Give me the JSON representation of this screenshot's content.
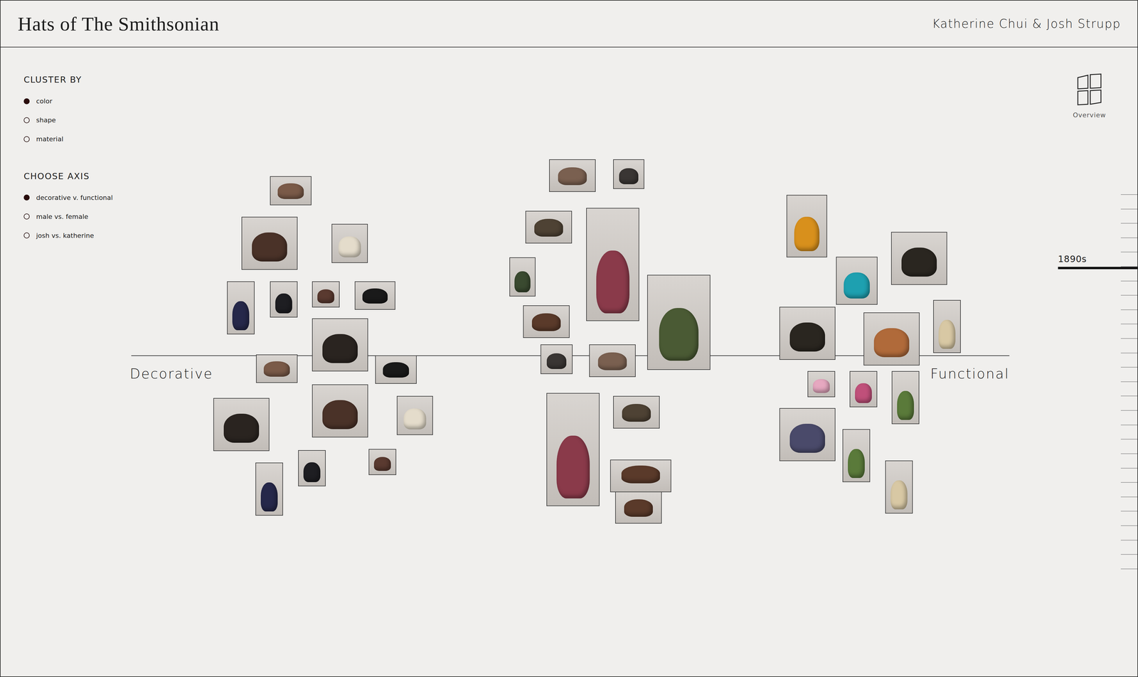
{
  "header": {
    "title": "Hats of The Smithsonian",
    "authors": "Katherine Chui & Josh Strupp"
  },
  "cluster_by": {
    "heading": "CLUSTER BY",
    "options": [
      {
        "label": "color",
        "selected": true
      },
      {
        "label": "shape",
        "selected": false
      },
      {
        "label": "material",
        "selected": false
      }
    ]
  },
  "axis_choice": {
    "heading": "CHOOSE AXIS",
    "options": [
      {
        "label": "decorative v. functional",
        "selected": true
      },
      {
        "label": "male vs. female",
        "selected": false
      },
      {
        "label": "josh vs. katherine",
        "selected": false
      }
    ]
  },
  "overview": {
    "label": "Overview"
  },
  "timeline": {
    "current": "1890s"
  },
  "chart": {
    "left_label": "Decorative",
    "right_label": "Functional",
    "hats": [
      {
        "color": "#7a5a48"
      },
      {
        "color": "#4a3228"
      },
      {
        "color": "#e4dccb"
      },
      {
        "color": "#26284a"
      },
      {
        "color": "#1e1e22"
      },
      {
        "color": "#5a3a30"
      },
      {
        "color": "#1a1a1a"
      },
      {
        "color": "#2a2420"
      },
      {
        "color": "#7a5a48"
      },
      {
        "color": "#1a1a1a"
      },
      {
        "color": "#2a2420"
      },
      {
        "color": "#4a3228"
      },
      {
        "color": "#e4dccb"
      },
      {
        "color": "#26284a"
      },
      {
        "color": "#1e1e22"
      },
      {
        "color": "#5a3a30"
      },
      {
        "color": "#7a6050"
      },
      {
        "color": "#3a3634"
      },
      {
        "color": "#4e4234"
      },
      {
        "color": "#8a3a4a"
      },
      {
        "color": "#3a4a30"
      },
      {
        "color": "#5a3a2a"
      },
      {
        "color": "#4a5a34"
      },
      {
        "color": "#3a3634"
      },
      {
        "color": "#7a6050"
      },
      {
        "color": "#8a3a4a"
      },
      {
        "color": "#4e4234"
      },
      {
        "color": "#5a3a2a"
      },
      {
        "color": "#5a3a2a"
      },
      {
        "color": "#d8901c"
      },
      {
        "color": "#1ea0b0"
      },
      {
        "color": "#2a2620"
      },
      {
        "color": "#d8c8a4"
      },
      {
        "color": "#2a2620"
      },
      {
        "color": "#b06a3a"
      },
      {
        "color": "#e6a8c0"
      },
      {
        "color": "#c0507a"
      },
      {
        "color": "#5a7a3a"
      },
      {
        "color": "#4a4a6a"
      },
      {
        "color": "#5a7a3a"
      },
      {
        "color": "#d8c8a4"
      }
    ]
  }
}
